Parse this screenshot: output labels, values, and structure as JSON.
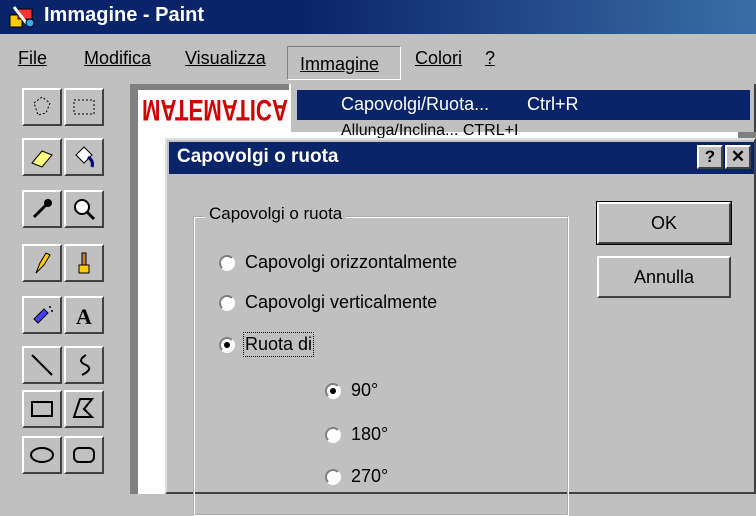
{
  "window": {
    "title": "Immagine - Paint"
  },
  "menu": {
    "file": "File",
    "modifica": "Modifica",
    "visualizza": "Visualizza",
    "immagine": "Immagine",
    "colori": "Colori",
    "help": "?"
  },
  "dropdown": {
    "selected_label": "Capovolgi/Ruota...",
    "selected_shortcut": "Ctrl+R",
    "next_partial": "Allunga/Inclina...    CTRL+I"
  },
  "canvas": {
    "text": "MATEMATICA"
  },
  "dialog": {
    "title": "Capovolgi o ruota",
    "help_btn": "?",
    "close_btn": "✕",
    "group_label": "Capovolgi o ruota",
    "options": [
      {
        "label": "Capovolgi orizzontalmente",
        "checked": false
      },
      {
        "label": "Capovolgi verticalmente",
        "checked": false
      },
      {
        "label": "Ruota di",
        "checked": true
      }
    ],
    "angles": [
      {
        "label": "90°",
        "checked": true
      },
      {
        "label": "180°",
        "checked": false
      },
      {
        "label": "270°",
        "checked": false
      }
    ],
    "ok": "OK",
    "cancel": "Annulla"
  },
  "tools": [
    "free-select-icon",
    "rect-select-icon",
    "eraser-icon",
    "fill-icon",
    "picker-icon",
    "magnifier-icon",
    "pencil-icon",
    "brush-icon",
    "airbrush-icon",
    "text-icon",
    "line-icon",
    "curve-icon",
    "rectangle-icon",
    "polygon-icon",
    "ellipse-icon",
    "rounded-rect-icon"
  ],
  "colors": {
    "titlebar": "#0a246a",
    "face": "#c0c0c0"
  }
}
